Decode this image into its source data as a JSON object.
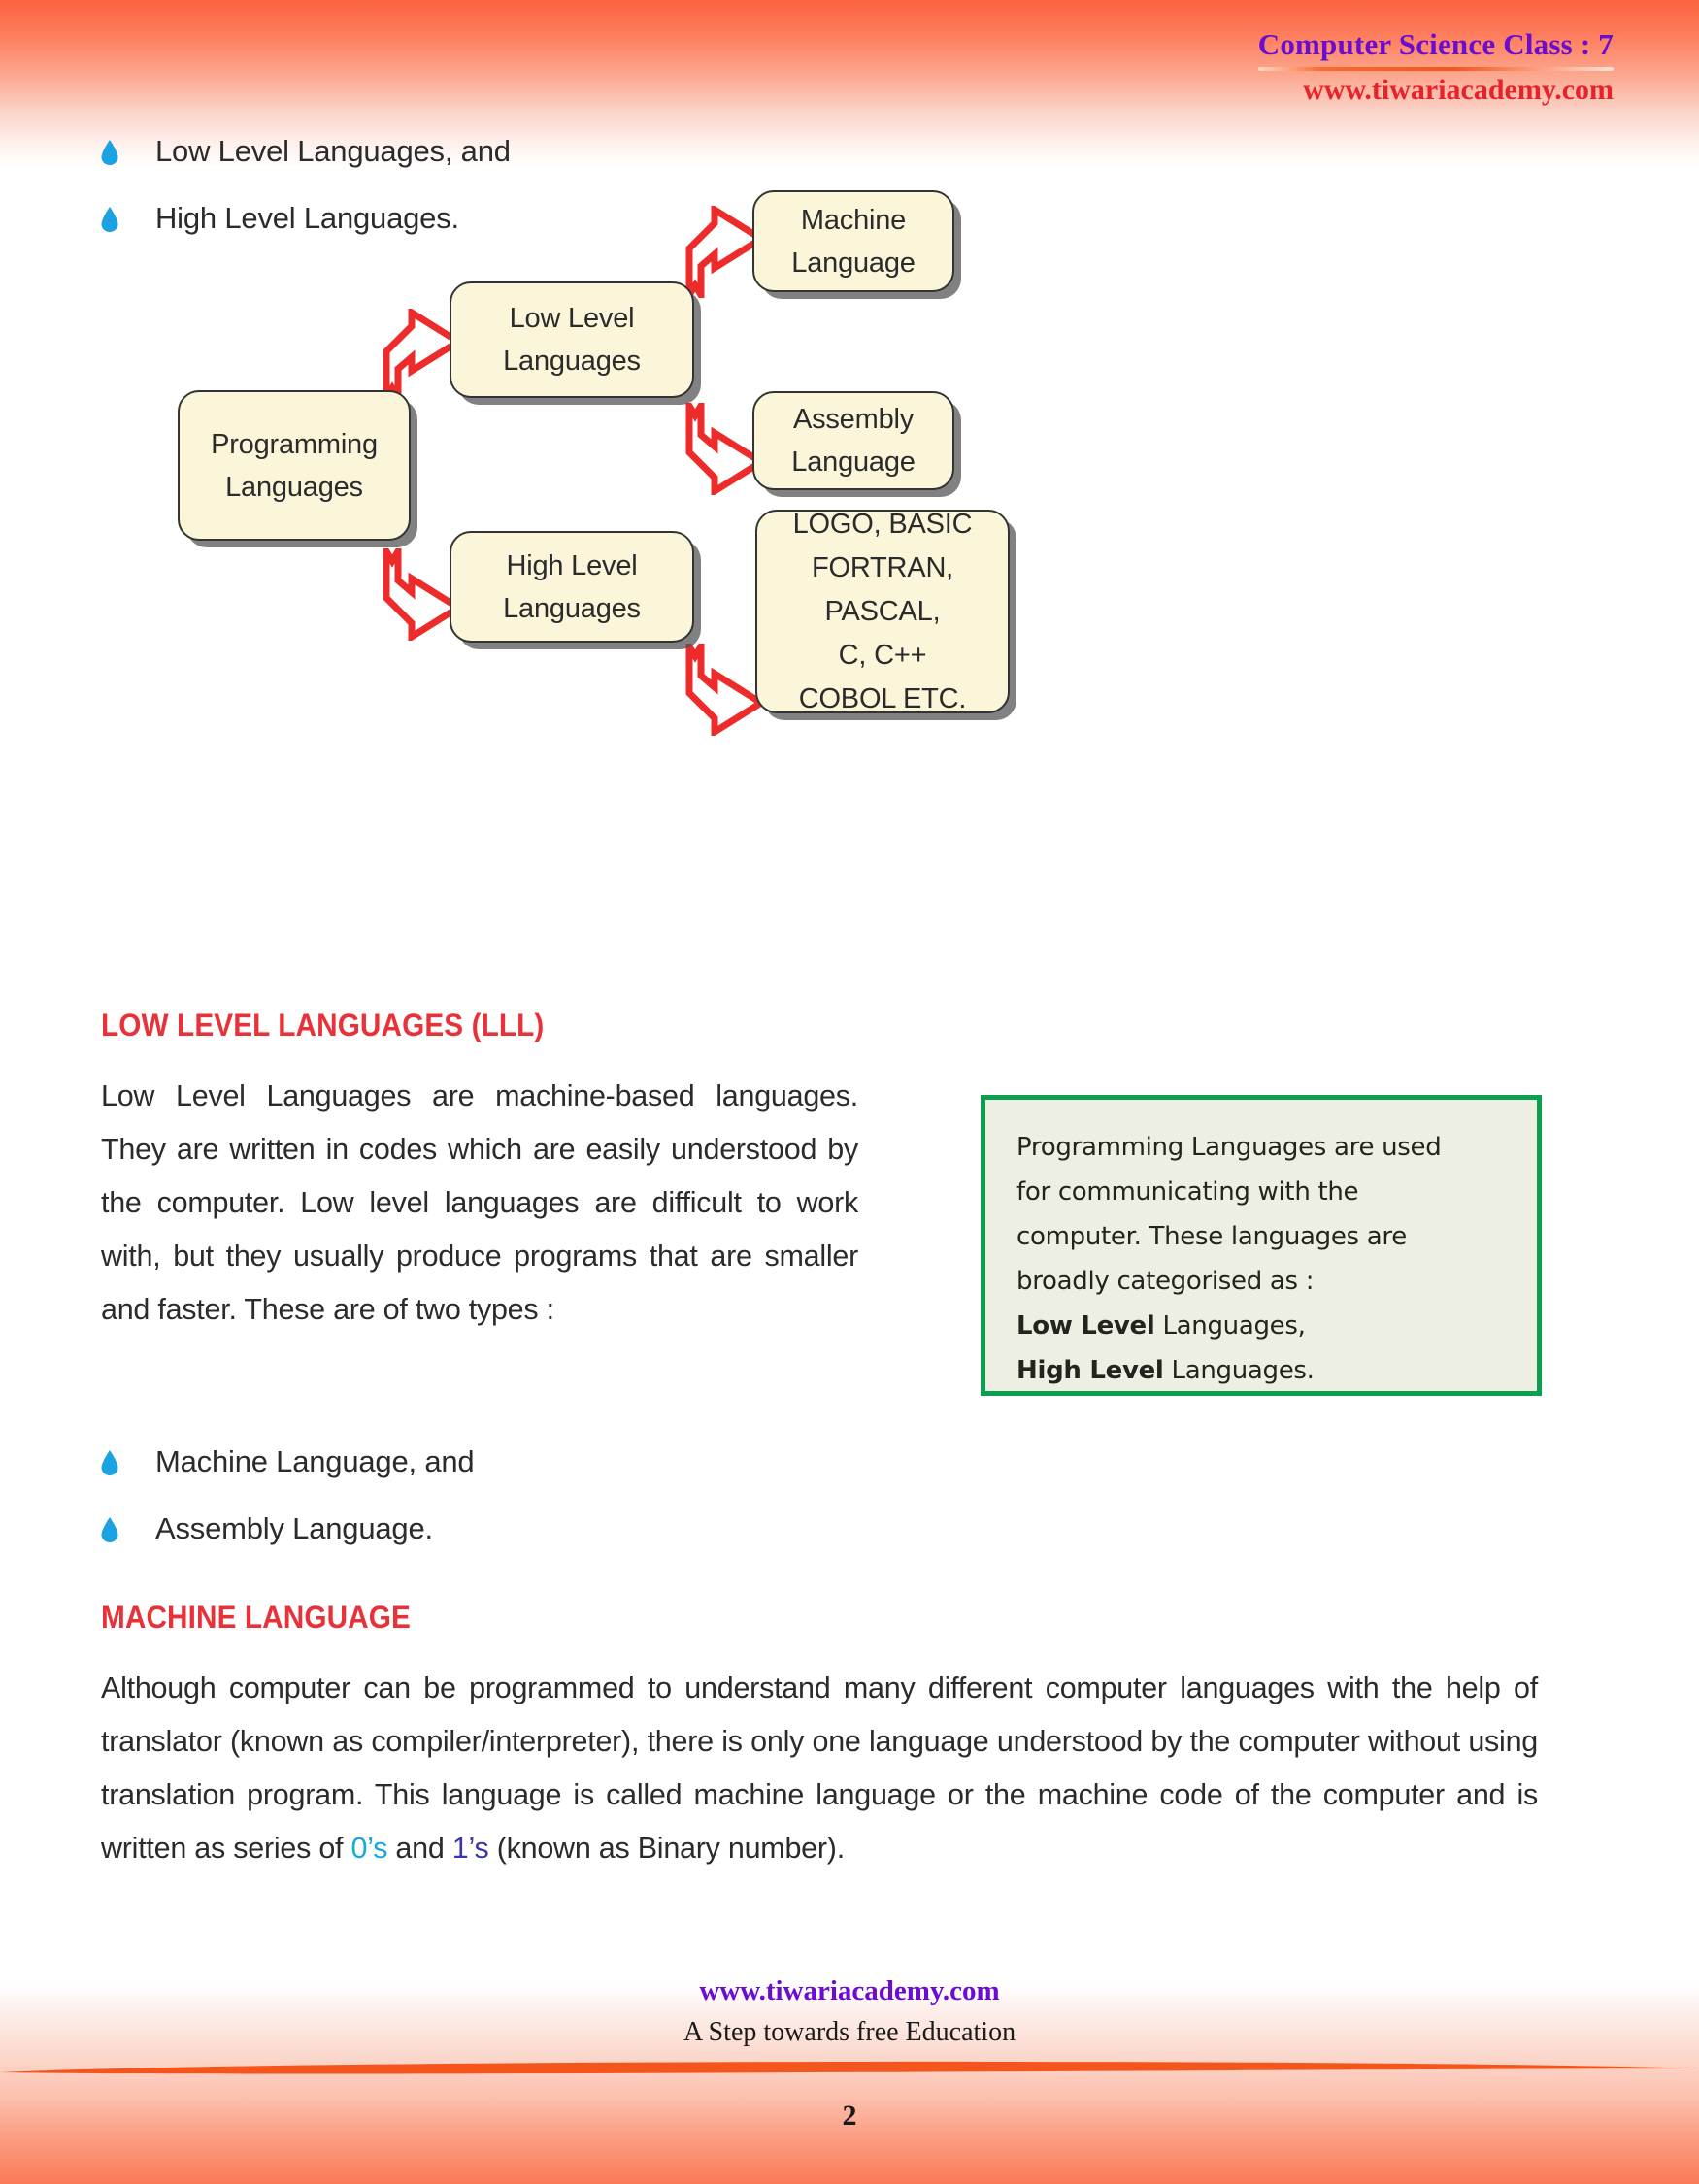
{
  "header": {
    "title": "Computer Science Class : 7",
    "site": "www.tiwariacademy.com"
  },
  "top_bullets": [
    {
      "text": "Low Level Languages, and"
    },
    {
      "text": "High Level Languages."
    }
  ],
  "flowchart": {
    "nodes": [
      {
        "id": "programming-languages",
        "line1": "Programming",
        "line2": "Languages"
      },
      {
        "id": "low-level-languages",
        "line1": "Low Level",
        "line2": "Languages"
      },
      {
        "id": "high-level-languages",
        "line1": "High Level",
        "line2": "Languages"
      },
      {
        "id": "machine-language",
        "line1": "Machine",
        "line2": "Language"
      },
      {
        "id": "assembly-language",
        "line1": "Assembly",
        "line2": "Language"
      },
      {
        "id": "hll-examples",
        "lines": [
          "LOGO, BASIC",
          "FORTRAN,",
          "PASCAL,",
          "C, C++",
          "COBOL ETC."
        ]
      }
    ],
    "arrow_color": "#ee2b2b"
  },
  "sections": [
    {
      "id": "low-level-languages",
      "heading": "LOW LEVEL LANGUAGES (LLL)",
      "body": "Low Level Languages are machine-based languages. They are written in codes which are easily understood by the computer. Low level languages are difficult to work with, but they usually produce programs that are smaller and faster. These are of two types :",
      "bullets": [
        {
          "text": "Machine Language, and"
        },
        {
          "text": "Assembly Language."
        }
      ]
    },
    {
      "id": "machine-language",
      "heading": "MACHINE LANGUAGE",
      "body_parts": {
        "before": "Although computer can be programmed to understand many different computer languages with the help of translator (known as compiler/interpreter), there is only one language understood by the computer without using translation program. This language is called machine language or the machine code of the computer and is written as series of ",
        "zero": "0’s",
        "middle": " and ",
        "one": "1’s",
        "after": " (known as Binary number)."
      }
    }
  ],
  "callout": {
    "line1": "Programming Languages are used",
    "line2": "for communicating with the",
    "line3": "computer. These languages are",
    "line4": "broadly categorised as :",
    "line5_bold": "Low  Level",
    "line5_rest": " Languages,",
    "line6_bold": "High Level",
    "line6_rest": " Languages.",
    "border_color": "#0aa050",
    "background_color": "#ecefe1"
  },
  "footer": {
    "site": "www.tiwariacademy.com",
    "tagline": "A Step towards free Education",
    "page_number": "2"
  },
  "colors": {
    "heading_red": "#e8323a",
    "header_purple": "#6a0dd0",
    "header_red": "#e8222a",
    "bullet_blue": "#1aa3e0",
    "node_fill": "#fbf6d9",
    "accent_orange": "#fc6340"
  }
}
